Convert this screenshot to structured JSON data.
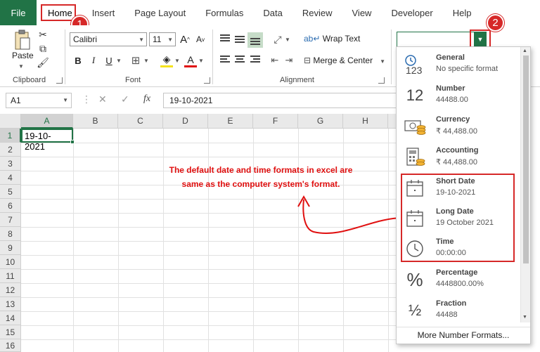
{
  "ribbon_tabs": [
    "File",
    "Home",
    "Insert",
    "Page Layout",
    "Formulas",
    "Data",
    "Review",
    "View",
    "Developer",
    "Help"
  ],
  "badges": [
    "1",
    "2"
  ],
  "clipboard": {
    "paste_label": "Paste",
    "group_label": "Clipboard"
  },
  "font": {
    "name": "Calibri",
    "size": "11",
    "group_label": "Font",
    "bold": "B",
    "italic": "I",
    "underline": "U",
    "grow": "A",
    "shrink": "A"
  },
  "alignment": {
    "wrap_text": "Wrap Text",
    "merge_center": "Merge & Center",
    "group_label": "Alignment"
  },
  "formula_bar": {
    "name_box": "A1",
    "cancel": "✕",
    "enter": "✓",
    "fx": "fx",
    "value": "19-10-2021"
  },
  "columns": [
    "A",
    "B",
    "C",
    "D",
    "E",
    "F",
    "G",
    "H"
  ],
  "rows": [
    "1",
    "2",
    "3",
    "4",
    "5",
    "6",
    "7",
    "8",
    "9",
    "10",
    "11",
    "12",
    "13",
    "14",
    "15",
    "16"
  ],
  "cell_a1": "19-10-2021",
  "annotation": {
    "line1": "The default date and time formats in excel are",
    "line2": "same as the computer system's format."
  },
  "number_formats": [
    {
      "name": "General",
      "sample": "No specific format",
      "icon": "general-123-icon"
    },
    {
      "name": "Number",
      "sample": "44488.00",
      "icon": "number-12-icon"
    },
    {
      "name": "Currency",
      "sample": "₹ 44,488.00",
      "icon": "currency-coins-icon"
    },
    {
      "name": "Accounting",
      "sample": " ₹ 44,488.00",
      "icon": "accounting-calculator-icon"
    },
    {
      "name": "Short Date",
      "sample": "19-10-2021",
      "icon": "calendar-icon"
    },
    {
      "name": "Long Date",
      "sample": "19 October 2021",
      "icon": "calendar-icon"
    },
    {
      "name": "Time",
      "sample": "00:00:00",
      "icon": "clock-icon"
    },
    {
      "name": "Percentage",
      "sample": "4448800.00%",
      "icon": "percent-icon"
    },
    {
      "name": "Fraction",
      "sample": "44488",
      "icon": "fraction-icon"
    }
  ],
  "more_formats": "More Number Formats...",
  "colors": {
    "excel_green": "#217346",
    "highlight_red": "#d62828",
    "annotation_red": "#e01010"
  }
}
